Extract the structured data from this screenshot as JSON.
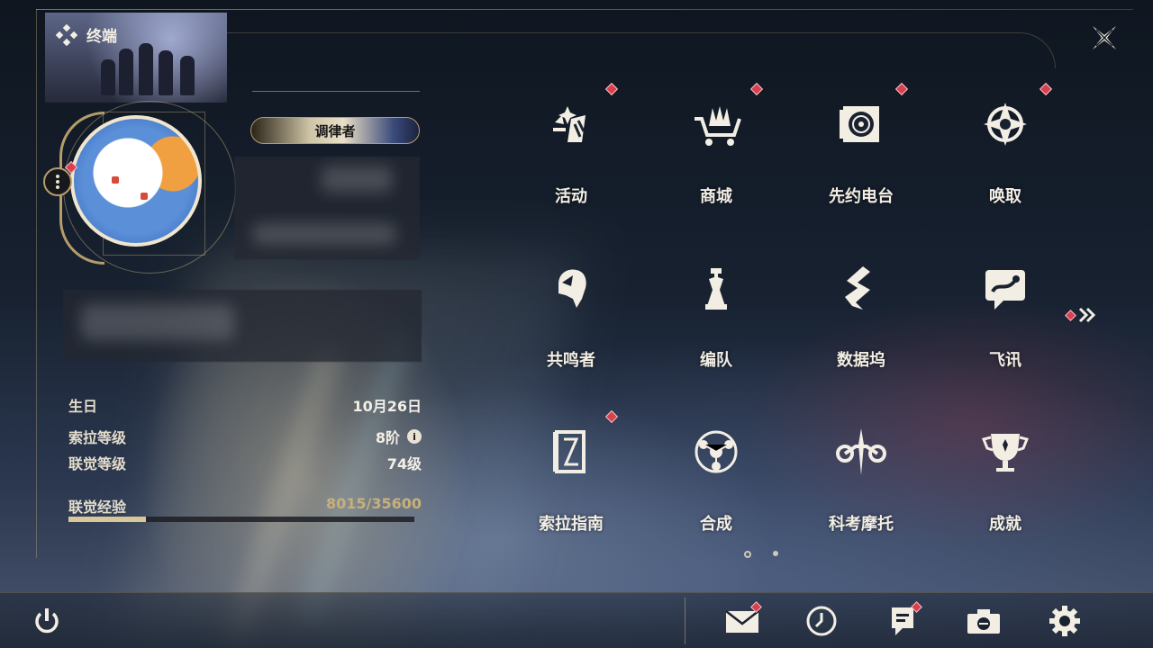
{
  "header": {
    "terminal_title": "终端"
  },
  "profile": {
    "title_badge": "调律者",
    "birthday_label": "生日",
    "birthday_value": "10月26日",
    "sola_level_label": "索拉等级",
    "sola_level_value": "8阶",
    "union_level_label": "联觉等级",
    "union_level_value": "74级",
    "exp_label": "联觉经验",
    "exp_value": "8015/35600",
    "exp_progress": 0.225
  },
  "menu": {
    "items": [
      {
        "label": "活动",
        "icon": "activity-icon",
        "badge": true
      },
      {
        "label": "商城",
        "icon": "shop-icon",
        "badge": true
      },
      {
        "label": "先约电台",
        "icon": "radio-icon",
        "badge": true
      },
      {
        "label": "唤取",
        "icon": "convene-icon",
        "badge": true
      },
      {
        "label": "共鸣者",
        "icon": "resonator-icon",
        "badge": false
      },
      {
        "label": "编队",
        "icon": "team-icon",
        "badge": false
      },
      {
        "label": "数据坞",
        "icon": "data-bank-icon",
        "badge": false
      },
      {
        "label": "飞讯",
        "icon": "message-icon",
        "badge": false
      },
      {
        "label": "索拉指南",
        "icon": "guidebook-icon",
        "badge": true
      },
      {
        "label": "合成",
        "icon": "synthesis-icon",
        "badge": false
      },
      {
        "label": "科考摩托",
        "icon": "motorcycle-icon",
        "badge": false
      },
      {
        "label": "成就",
        "icon": "achievement-icon",
        "badge": false
      }
    ],
    "page_current": 1,
    "page_total": 2
  },
  "bottom_bar": {
    "buttons": [
      "power-icon",
      "mail-icon",
      "clock-icon",
      "notice-icon",
      "camera-icon",
      "settings-icon"
    ]
  },
  "colors": {
    "accent_gold": "#b69c6a",
    "badge_red": "#d8404e",
    "text": "#f2eee4"
  }
}
